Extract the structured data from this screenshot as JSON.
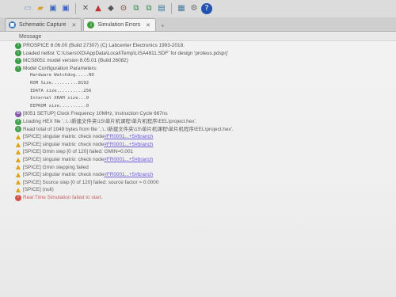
{
  "toolbar": {
    "icons": [
      {
        "name": "new-file-icon",
        "glyph": "▭",
        "color": "#8aa0c8"
      },
      {
        "name": "open-folder-icon",
        "glyph": "▰",
        "color": "#d8a030"
      },
      {
        "name": "save-icon",
        "glyph": "▣",
        "color": "#3a66c0"
      },
      {
        "name": "save-all-icon",
        "glyph": "▣",
        "color": "#3a66c0"
      },
      {
        "name": "close-window-icon",
        "glyph": "✕",
        "color": "#555555"
      },
      {
        "name": "component-icon",
        "glyph": "▲",
        "color": "#c03030"
      },
      {
        "name": "device-icon",
        "glyph": "◆",
        "color": "#555555"
      },
      {
        "name": "pickup-icon",
        "glyph": "⊙",
        "color": "#8a2020"
      },
      {
        "name": "annotate-icon",
        "glyph": "⧉",
        "color": "#2a8a4a"
      },
      {
        "name": "netlist-icon",
        "glyph": "⧉",
        "color": "#2a8a4a"
      },
      {
        "name": "bom-icon",
        "glyph": "▤",
        "color": "#3a7a9a"
      },
      {
        "name": "tools-icon",
        "glyph": "▦",
        "color": "#4a7a9a"
      },
      {
        "name": "settings-icon",
        "glyph": "⚙",
        "color": "#666666"
      },
      {
        "name": "help-icon",
        "glyph": "?",
        "color": "#2050b0"
      }
    ]
  },
  "tabs": [
    {
      "label": "Schematic Capture",
      "active": false
    },
    {
      "label": "Simulation Errors",
      "active": true
    }
  ],
  "messages": {
    "header": "Message",
    "rows": [
      {
        "sev": "info",
        "text": "PROSPICE 8.06.00 (Build 27307) (C) Labcenter Electronics 1993-2018."
      },
      {
        "sev": "info",
        "text": "Loaded netlist 'C:\\Users\\XD\\AppData\\Local\\Temp\\LISA4811.SDF' for design 'proteus.pdsprj'"
      },
      {
        "sev": "info",
        "text": "MCS8051 model version 8.05.01 (Build 26082)"
      },
      {
        "sev": "info",
        "text": "Model Configuration Parameters:"
      },
      {
        "sev": "indent",
        "text": "Hardware Watchdog.....NO"
      },
      {
        "sev": "indent",
        "text": "ROM Size..........8192"
      },
      {
        "sev": "indent",
        "text": "IDATA size..........256"
      },
      {
        "sev": "indent",
        "text": "Internal XRAM size...0"
      },
      {
        "sev": "indent",
        "text": "EEPROM size..........0"
      },
      {
        "sev": "setup",
        "text": "[8051 SETUP] Clock Frequency 10MHz, Instruction Cycle 667ns"
      },
      {
        "sev": "info",
        "text": "Loading HEX file '..\\..\\新建文件夹\\15\\单片机课程\\单片机程序\\EEL\\project.hex'."
      },
      {
        "sev": "info",
        "text": "Read total of 1049 bytes from file '..\\..\\新建文件夹\\15\\单片机课程\\单片机程序\\EEL\\project.hex'."
      },
      {
        "sev": "warn",
        "text": "[SPICE] singular matrix: check node ",
        "link": "#FR0001...+5#branch"
      },
      {
        "sev": "warn",
        "text": "[SPICE] singular matrix: check node ",
        "link": "#FR0001...+5#branch"
      },
      {
        "sev": "warn",
        "text": "[SPICE] Gmin step [0 of 120] failed: GMIN=0.001"
      },
      {
        "sev": "warn",
        "text": "[SPICE] singular matrix: check node ",
        "link": "#FR0001...+5#branch"
      },
      {
        "sev": "warn",
        "text": "[SPICE] Gmin stepping failed"
      },
      {
        "sev": "warn",
        "text": "[SPICE] singular matrix: check node ",
        "link": "#FR0001...+5#branch"
      },
      {
        "sev": "warn",
        "text": "[SPICE] Source step [0 of 120] failed: source factor = 0.0000"
      },
      {
        "sev": "warn",
        "text": "[SPICE] (null)"
      },
      {
        "sev": "error",
        "text": "Real Time Simulation failed to start."
      }
    ]
  },
  "colors": {
    "info": "#2f9a3c",
    "warn": "#d89a00",
    "error": "#d23a2a",
    "link": "#5a4ad0"
  }
}
